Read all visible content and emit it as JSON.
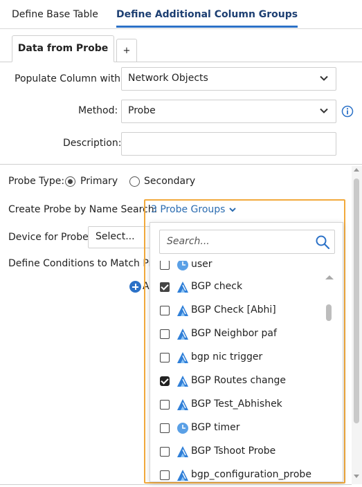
{
  "top_tabs": [
    {
      "label": "Define Base Table"
    },
    {
      "label": "Define Additional Column Groups"
    }
  ],
  "sub_tabs": {
    "active_label": "Data from Probe",
    "add_label": "+"
  },
  "form": {
    "populate_label": "Populate Column with:",
    "populate_value": "Network Objects",
    "method_label": "Method:",
    "method_value": "Probe",
    "description_label": "Description:",
    "description_value": ""
  },
  "probe_section": {
    "probe_type_label": "Probe Type:",
    "primary_label": "Primary",
    "secondary_label": "Secondary",
    "create_by_name_label": "Create Probe by Name Search:",
    "probe_groups_link": "3 Probe Groups",
    "device_label": "Device for Probe:",
    "device_value": "Select...",
    "conditions_label": "Define Conditions to Match Prob",
    "add_label": "A"
  },
  "dropdown": {
    "search_placeholder": "Search...",
    "items": [
      {
        "label": "user",
        "checked": false,
        "icon": "clock-icon"
      },
      {
        "label": "BGP check",
        "checked": true,
        "icon": "probe-icon"
      },
      {
        "label": "BGP Check [Abhi]",
        "checked": false,
        "icon": "probe-icon"
      },
      {
        "label": "BGP Neighbor paf",
        "checked": false,
        "icon": "probe-icon"
      },
      {
        "label": "bgp nic trigger",
        "checked": false,
        "icon": "probe-icon"
      },
      {
        "label": "BGP Routes change",
        "checked": true,
        "icon": "probe-icon"
      },
      {
        "label": "BGP Test_Abhishek",
        "checked": false,
        "icon": "probe-icon"
      },
      {
        "label": "BGP timer",
        "checked": false,
        "icon": "clock-icon"
      },
      {
        "label": "BGP Tshoot Probe",
        "checked": false,
        "icon": "probe-icon"
      },
      {
        "label": "bgp_configuration_probe",
        "checked": false,
        "icon": "probe-icon"
      }
    ]
  },
  "colors": {
    "accent": "#2b71c7",
    "highlight_frame": "#f2a93b",
    "link": "#2b6cb0"
  }
}
